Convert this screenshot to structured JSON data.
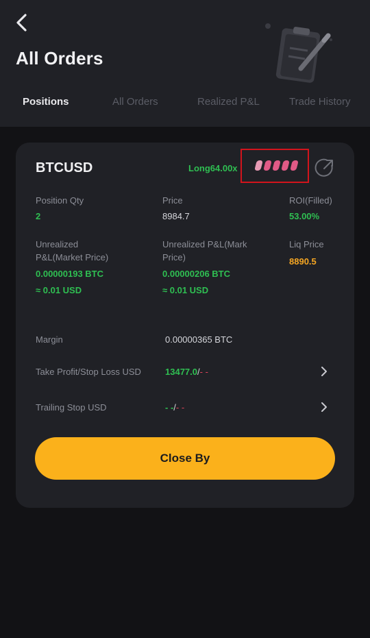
{
  "header": {
    "title": "All Orders",
    "tabs": [
      {
        "label": "Positions"
      },
      {
        "label": "All Orders"
      },
      {
        "label": "Realized P&L"
      },
      {
        "label": "Trade History"
      }
    ]
  },
  "position": {
    "symbol": "BTCUSD",
    "side_leverage": "Long64.00x",
    "leverage_level": {
      "filled_bars": 5,
      "total_bars": 5
    },
    "fields": {
      "position_qty": {
        "label": "Position Qty",
        "value": "2"
      },
      "price": {
        "label": "Price",
        "value": "8984.7"
      },
      "roi": {
        "label": "ROI(Filled)",
        "value": "53.00%"
      },
      "unrealized_market": {
        "label_line1": "Unrealized",
        "label_line2": "P&L(Market Price)",
        "value": "0.00000193 BTC",
        "usd": "≈ 0.01 USD"
      },
      "unrealized_mark": {
        "label_line1": "Unrealized P&L(Mark",
        "label_line2": "Price)",
        "value": "0.00000206 BTC",
        "usd": "≈ 0.01 USD"
      },
      "liq_price": {
        "label": "Liq Price",
        "value": "8890.5"
      },
      "margin": {
        "label": "Margin",
        "value": "0.00000365 BTC"
      },
      "tp_sl": {
        "label": "Take Profit/Stop Loss USD",
        "tp_value": "13477.0",
        "separator": "/",
        "sl_value": "- -"
      },
      "trailing_stop": {
        "label": "Trailing Stop USD",
        "value_left": "- -",
        "separator": "/",
        "value_right": "- -"
      }
    },
    "close_button_label": "Close By"
  },
  "colors": {
    "accent": "#fbb11b",
    "positive": "#2fbf52",
    "negative": "#e0435a",
    "liq": "#f5a623",
    "highlight_box": "#d3141c"
  },
  "icons": [
    "back-arrow-icon",
    "clipboard-pen-illustration",
    "share-icon",
    "chevron-right-icon"
  ]
}
